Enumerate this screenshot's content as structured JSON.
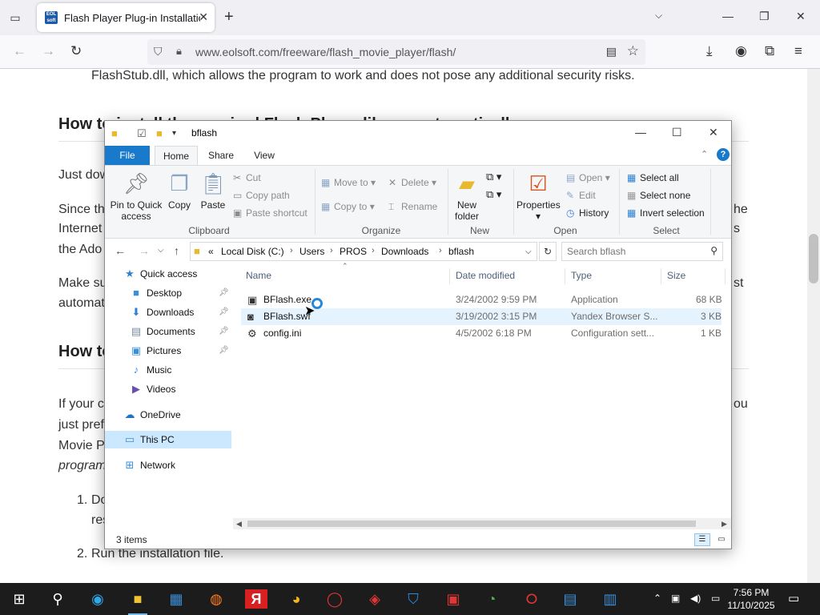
{
  "browser": {
    "tab_title": "Flash Player Plug-in Installation",
    "favicon_text": "EOL soft",
    "url": "www.eolsoft.com/freeware/flash_movie_player/flash/"
  },
  "page": {
    "line1": "FlashStub.dll, which allows the program to work and does not pose any additional security risks.",
    "heading1": "How to install the required Flash Player library automatically",
    "p1": "Just dow",
    "p2a": "Since th",
    "p2a_right": "he",
    "p2b": "Internet",
    "p2b_right": "s",
    "p2c": "the Ado",
    "p3a": "Make su",
    "p3a_right": "st",
    "p3b": "automat",
    "heading2": "How to",
    "p4a": "If your c",
    "p4a_right": "ou",
    "p4b": "just pref",
    "p4c": "Movie P",
    "p4d": "program",
    "li1_num": "1.",
    "li1a": "Do",
    "li1b": "res",
    "li2_num": "2.",
    "li2": "Run the installation file."
  },
  "explorer": {
    "title": "bflash",
    "tabs": {
      "file": "File",
      "home": "Home",
      "share": "Share",
      "view": "View"
    },
    "ribbon": {
      "pin": "Pin to Quick access",
      "copy": "Copy",
      "paste": "Paste",
      "cut": "Cut",
      "copy_path": "Copy path",
      "paste_shortcut": "Paste shortcut",
      "clipboard": "Clipboard",
      "move_to": "Move to",
      "copy_to": "Copy to",
      "delete": "Delete",
      "rename": "Rename",
      "organize": "Organize",
      "new_folder": "New folder",
      "new": "New",
      "properties": "Properties",
      "open": "Open",
      "edit": "Edit",
      "history": "History",
      "open_group": "Open",
      "select_all": "Select all",
      "select_none": "Select none",
      "invert_selection": "Invert selection",
      "select": "Select"
    },
    "address": {
      "prefix": "«",
      "crumbs": [
        "Local Disk (C:)",
        "Users",
        "PROS",
        "Downloads",
        "bflash"
      ]
    },
    "search_placeholder": "Search bflash",
    "nav": {
      "quick_access": "Quick access",
      "desktop": "Desktop",
      "downloads": "Downloads",
      "documents": "Documents",
      "pictures": "Pictures",
      "music": "Music",
      "videos": "Videos",
      "onedrive": "OneDrive",
      "this_pc": "This PC",
      "network": "Network"
    },
    "columns": {
      "name": "Name",
      "date": "Date modified",
      "type": "Type",
      "size": "Size"
    },
    "files": [
      {
        "name": "BFlash.exe",
        "date": "3/24/2002 9:59 PM",
        "type": "Application",
        "size": "68 KB"
      },
      {
        "name": "BFlash.swf",
        "date": "3/19/2002 3:15 PM",
        "type": "Yandex Browser S...",
        "size": "3 KB"
      },
      {
        "name": "config.ini",
        "date": "4/5/2002 6:18 PM",
        "type": "Configuration sett...",
        "size": "1 KB"
      }
    ],
    "status": "3 items"
  },
  "taskbar": {
    "time": "7:56 PM",
    "date": "11/10/2025"
  }
}
